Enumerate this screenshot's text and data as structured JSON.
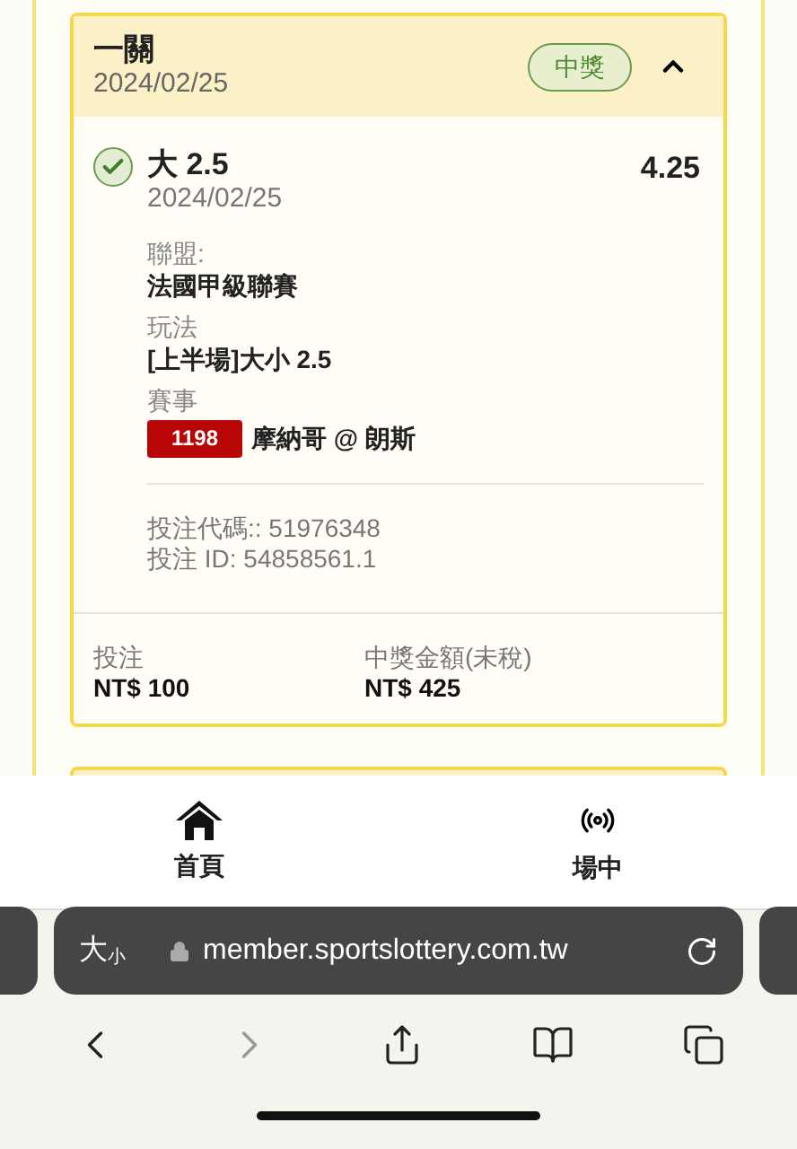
{
  "bet": {
    "title": "一關",
    "date": "2024/02/25",
    "badge": "中獎",
    "expanded": true,
    "selection": {
      "won": true,
      "name": "大 2.5",
      "date": "2024/02/25",
      "odds": "4.25"
    },
    "details": [
      {
        "label": "聯盟:",
        "value": "法國甲級聯賽"
      },
      {
        "label": "玩法",
        "value": "[上半場]大小 2.5"
      }
    ],
    "event": {
      "label": "賽事",
      "code": "1198",
      "teams": "摩納哥 @ 朗斯"
    },
    "codes": [
      "投注代碼:: 51976348",
      "投注 ID: 54858561.1"
    ],
    "summary": [
      {
        "label": "投注",
        "value": "NT$ 100"
      },
      {
        "label": "中獎金額(未稅)",
        "value": "NT$ 425"
      }
    ]
  },
  "bottom_nav": [
    {
      "kind": "home",
      "label": "首頁"
    },
    {
      "kind": "live",
      "label": "場中"
    }
  ],
  "browser": {
    "text_size": {
      "big": "大",
      "small": "小"
    },
    "url": "member.sportslottery.com.tw",
    "toolbar": [
      {
        "kind": "back",
        "disabled": false
      },
      {
        "kind": "forward",
        "disabled": true
      },
      {
        "kind": "share",
        "disabled": false
      },
      {
        "kind": "bookmarks",
        "disabled": false
      },
      {
        "kind": "tabs",
        "disabled": false
      }
    ]
  }
}
